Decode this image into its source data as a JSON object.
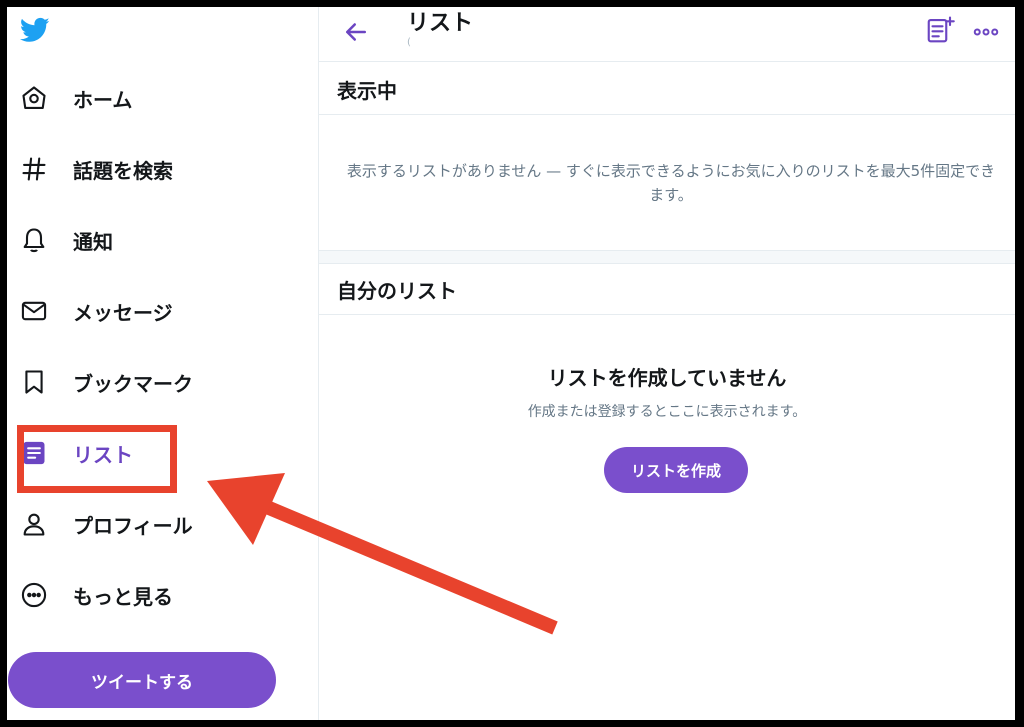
{
  "sidebar": {
    "items": [
      {
        "label": "ホーム",
        "icon": "home-icon"
      },
      {
        "label": "話題を検索",
        "icon": "hashtag-icon"
      },
      {
        "label": "通知",
        "icon": "bell-icon"
      },
      {
        "label": "メッセージ",
        "icon": "envelope-icon"
      },
      {
        "label": "ブックマーク",
        "icon": "bookmark-icon"
      },
      {
        "label": "リスト",
        "icon": "list-icon"
      },
      {
        "label": "プロフィール",
        "icon": "person-icon"
      },
      {
        "label": "もっと見る",
        "icon": "more-circle-icon"
      }
    ],
    "tweet_label": "ツイートする"
  },
  "header": {
    "title": "リスト",
    "subtitle": "("
  },
  "pinned": {
    "title": "表示中",
    "empty_text": "表示するリストがありません — すぐに表示できるようにお気に入りのリストを最大5件固定できます。"
  },
  "my_lists": {
    "title": "自分のリスト",
    "empty_title": "リストを作成していません",
    "empty_desc": "作成または登録するとここに表示されます。",
    "create_label": "リストを作成"
  },
  "colors": {
    "accent": "#7a4fcc",
    "annotation": "#e8432d",
    "twitter_blue": "#1da1f2"
  }
}
